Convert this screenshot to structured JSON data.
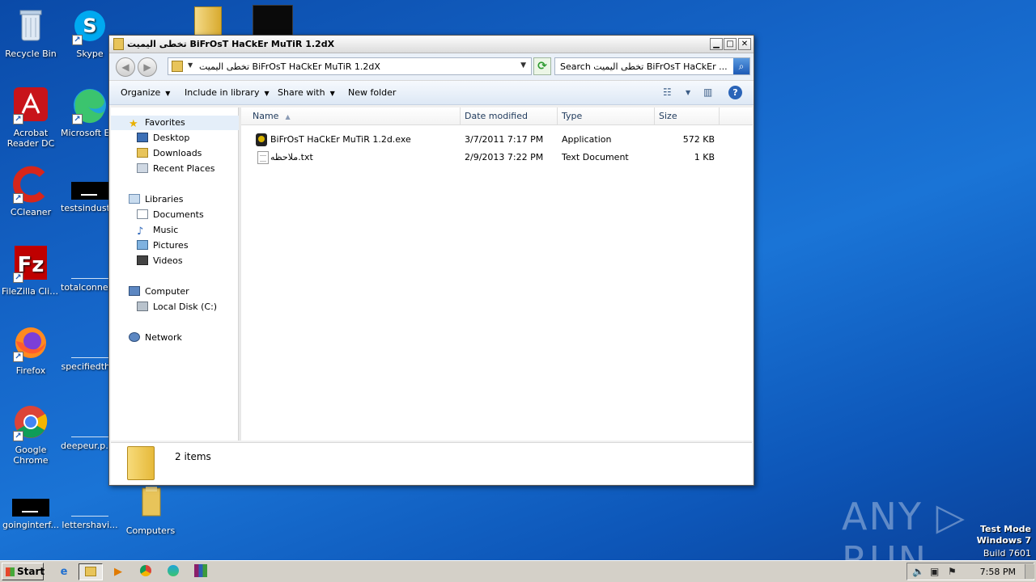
{
  "desktop": {
    "icons": [
      {
        "label": "Recycle Bin"
      },
      {
        "label": "Skype"
      },
      {
        "label": "Acrobat Reader DC"
      },
      {
        "label": "Microsoft Edge"
      },
      {
        "label": "CCleaner"
      },
      {
        "label": "testsindustr..."
      },
      {
        "label": "FileZilla Client"
      },
      {
        "label": "totalconnec..."
      },
      {
        "label": "Firefox"
      },
      {
        "label": "specifiedth..."
      },
      {
        "label": "Google Chrome"
      },
      {
        "label": "deepeur.pn..."
      },
      {
        "label": "goinginterf..."
      },
      {
        "label": "lettershavi..."
      },
      {
        "label": "Computers"
      }
    ]
  },
  "window": {
    "title": "تخطى اليميت BiFrOsT HaCkEr MuTiR 1.2dX",
    "address_path": "تخطى اليميت BiFrOsT HaCkEr MuTiR 1.2dX",
    "search_placeholder": "Search تخطى اليميت BiFrOsT HaCkEr ...",
    "toolbar": {
      "organize": "Organize",
      "include_in_library": "Include in library",
      "share_with": "Share with",
      "new_folder": "New folder"
    },
    "nav": {
      "favorites": "Favorites",
      "desktop": "Desktop",
      "downloads": "Downloads",
      "recent_places": "Recent Places",
      "libraries": "Libraries",
      "documents": "Documents",
      "music": "Music",
      "pictures": "Pictures",
      "videos": "Videos",
      "computer": "Computer",
      "local_disk": "Local Disk (C:)",
      "network": "Network"
    },
    "columns": {
      "name": "Name",
      "date_modified": "Date modified",
      "type": "Type",
      "size": "Size"
    },
    "files": [
      {
        "name": "BiFrOsT HaCkEr MuTiR 1.2d.exe",
        "date": "3/7/2011 7:17 PM",
        "type": "Application",
        "size": "572 KB"
      },
      {
        "name": "ملاحظه.txt",
        "date": "2/9/2013 7:22 PM",
        "type": "Text Document",
        "size": "1 KB"
      }
    ],
    "status_count": "2 items"
  },
  "taskbar": {
    "start_label": "Start",
    "clock": "7:58 PM"
  },
  "watermark": {
    "brand": "ANY ▷ RUN",
    "test_mode": "Test Mode",
    "os": "Windows 7",
    "build": "Build 7601"
  }
}
